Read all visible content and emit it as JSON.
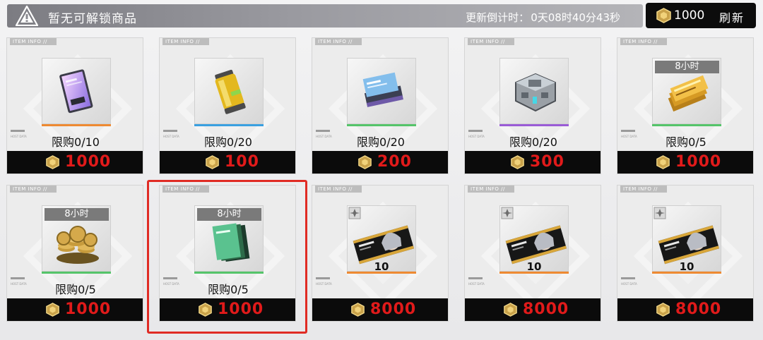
{
  "topbar": {
    "title": "暂无可解锁商品",
    "countdown_label": "更新倒计时：",
    "countdown_value": "0天08时40分43秒"
  },
  "currency": {
    "amount": "1000",
    "refresh_label": "刷新",
    "icon": "gold-coin-icon"
  },
  "colors": {
    "price_red": "#e11a1a",
    "rarity_orange": "#ee8a32",
    "rarity_blue": "#3aa0e0",
    "rarity_green": "#55c46a",
    "rarity_purple": "#9a5cd6",
    "highlight_red": "#e02b24"
  },
  "card_common": {
    "tab_label": "ITEM INFO //",
    "host_data_label": "HOST DATA"
  },
  "items": [
    {
      "icon": "id-card-icon",
      "limit": "限购0/10",
      "price": "1000",
      "rarity": "orange",
      "timer": "",
      "qty": ""
    },
    {
      "icon": "battery-canister-icon",
      "limit": "限购0/20",
      "price": "100",
      "rarity": "blue",
      "timer": "",
      "qty": ""
    },
    {
      "icon": "book-stack-icon",
      "limit": "限购0/20",
      "price": "200",
      "rarity": "green",
      "timer": "",
      "qty": ""
    },
    {
      "icon": "data-core-icon",
      "limit": "限购0/20",
      "price": "300",
      "rarity": "purple",
      "timer": "",
      "qty": ""
    },
    {
      "icon": "gold-tickets-icon",
      "limit": "限购0/5",
      "price": "1000",
      "rarity": "green",
      "timer": "8小时",
      "qty": ""
    },
    {
      "icon": "coin-pile-icon",
      "limit": "限购0/5",
      "price": "1000",
      "rarity": "green",
      "timer": "8小时",
      "qty": ""
    },
    {
      "icon": "green-tickets-icon",
      "limit": "限购0/5",
      "price": "1000",
      "rarity": "green",
      "timer": "8小时",
      "qty": ""
    },
    {
      "icon": "doll-card-icon",
      "limit": "",
      "price": "8000",
      "rarity": "orange",
      "timer": "",
      "qty": "10"
    },
    {
      "icon": "doll-card-icon",
      "limit": "",
      "price": "8000",
      "rarity": "orange",
      "timer": "",
      "qty": "10"
    },
    {
      "icon": "doll-card-icon",
      "limit": "",
      "price": "8000",
      "rarity": "orange",
      "timer": "",
      "qty": "10"
    }
  ]
}
